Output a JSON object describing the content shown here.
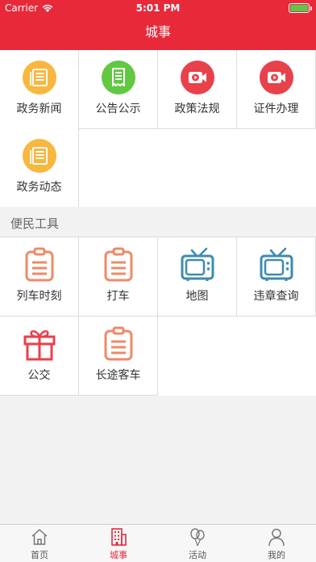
{
  "status_bar": {
    "carrier": "Carrier",
    "time": "5:01 PM"
  },
  "nav": {
    "title": "城事"
  },
  "gov_services": [
    {
      "label": "政务新闻",
      "icon": "news-icon",
      "color": "#f8b73e"
    },
    {
      "label": "公告公示",
      "icon": "receipt-icon",
      "color": "#62c842"
    },
    {
      "label": "政策法规",
      "icon": "video-icon",
      "color": "#e8414b"
    },
    {
      "label": "证件办理",
      "icon": "video-icon",
      "color": "#e8414b"
    },
    {
      "label": "政务动态",
      "icon": "news-icon",
      "color": "#f8b73e"
    }
  ],
  "tools_section": {
    "title": "便民工具"
  },
  "tools": [
    {
      "label": "列车时刻",
      "icon": "clipboard-icon",
      "color": "#ef8a68"
    },
    {
      "label": "打车",
      "icon": "clipboard-icon",
      "color": "#ef8a68"
    },
    {
      "label": "地图",
      "icon": "tv-icon",
      "color": "#3d8bb0"
    },
    {
      "label": "违章查询",
      "icon": "tv-icon",
      "color": "#3d8bb0"
    },
    {
      "label": "公交",
      "icon": "gift-icon",
      "color": "#e8414b"
    },
    {
      "label": "长途客车",
      "icon": "clipboard-icon",
      "color": "#ef8a68"
    }
  ],
  "tab_bar": {
    "active_color": "#e8293a",
    "tabs": [
      {
        "label": "首页",
        "icon": "home-icon"
      },
      {
        "label": "城事",
        "icon": "building-icon"
      },
      {
        "label": "活动",
        "icon": "balloons-icon"
      },
      {
        "label": "我的",
        "icon": "person-icon"
      }
    ]
  }
}
